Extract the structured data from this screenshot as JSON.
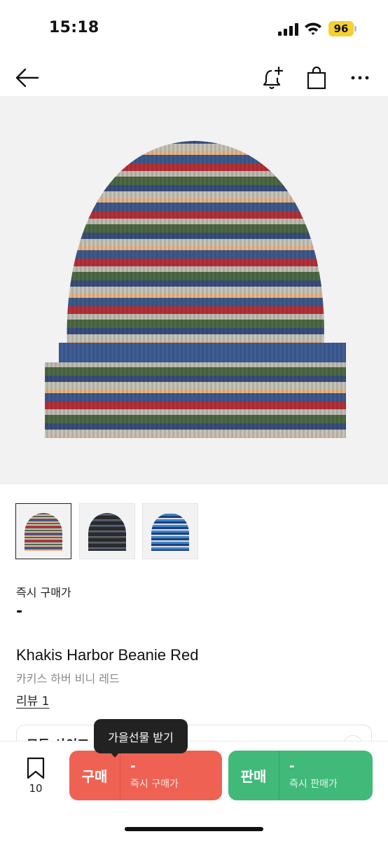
{
  "status_bar": {
    "time": "15:18",
    "battery": "96",
    "icons": [
      "signal-icon",
      "wifi-icon",
      "battery-icon"
    ]
  },
  "nav": {
    "icons": [
      "back-arrow-icon",
      "bell-plus-icon",
      "shopping-bag-icon",
      "more-dots-icon"
    ]
  },
  "product": {
    "price_label": "즉시 구매가",
    "price_value": "-",
    "name_en": "Khakis Harbor Beanie Red",
    "name_ko": "카키스 하버 비니 레드",
    "review_link": "리뷰 1",
    "thumbnails": [
      "red-striped",
      "black-striped",
      "blue-striped"
    ],
    "selected_thumbnail": 0
  },
  "size_selector": {
    "label": "모든 사이즈"
  },
  "bottom_bar": {
    "bookmark_count": "10",
    "buy": {
      "label": "구매",
      "price": "-",
      "sub": "즉시 구매가"
    },
    "sell": {
      "label": "판매",
      "price": "-",
      "sub": "즉시 판매가"
    },
    "tooltip": "가을선물 받기"
  },
  "colors": {
    "buy": "#ef6253",
    "sell": "#41b979",
    "battery": "#f5d033",
    "hero_bg": "#f2f2f3"
  }
}
